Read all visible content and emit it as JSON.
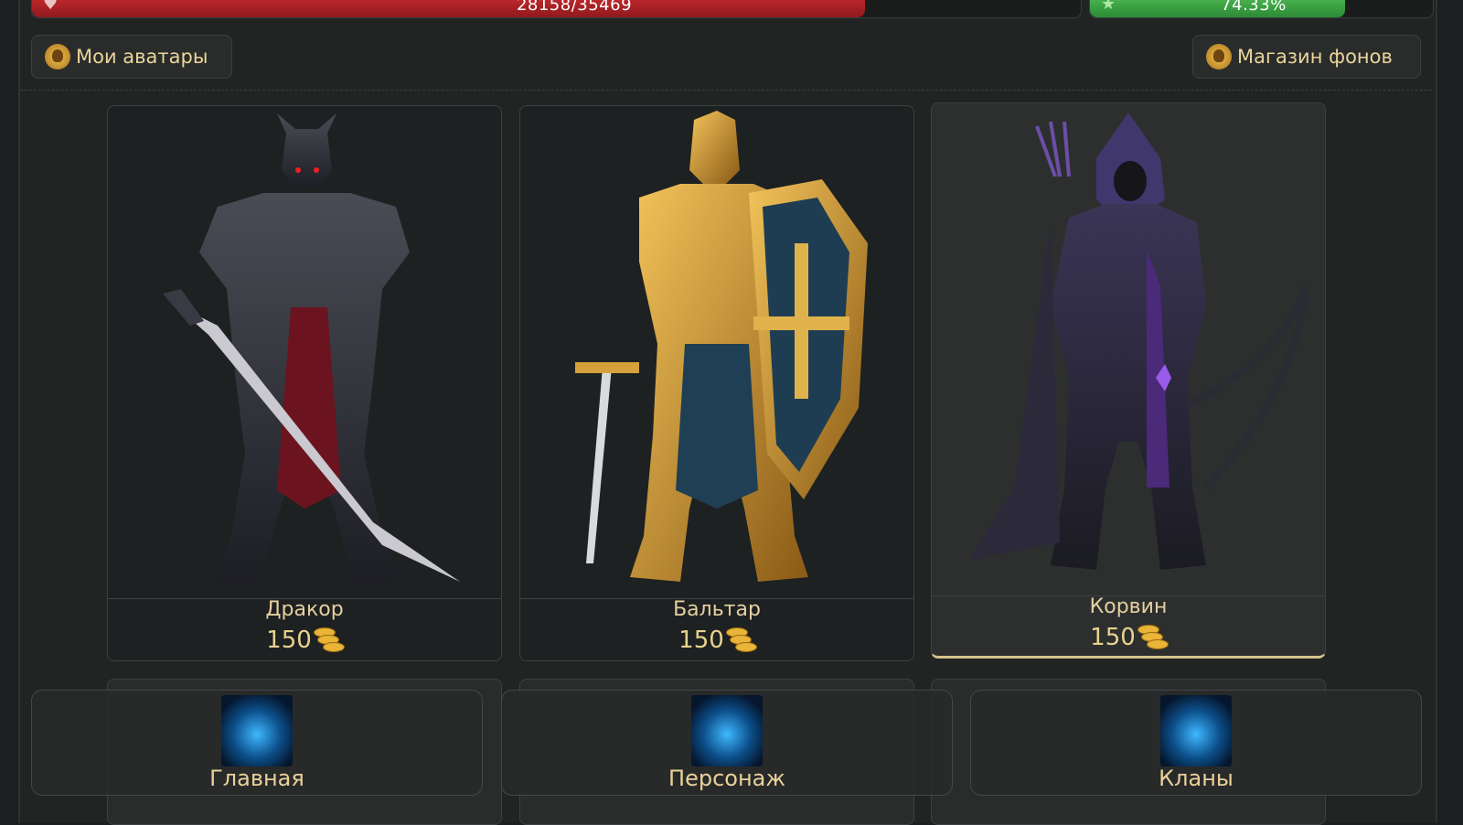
{
  "status": {
    "hp_text": "28158/35469",
    "hp_fraction": 0.7939,
    "xp_text": "74.33%",
    "xp_fraction": 0.7433
  },
  "header": {
    "my_avatars": "Мои аватары",
    "background_shop": "Магазин фонов"
  },
  "avatars": [
    {
      "name": "Дракор",
      "price": "150",
      "selected": false
    },
    {
      "name": "Бальтар",
      "price": "150",
      "selected": false
    },
    {
      "name": "Корвин",
      "price": "150",
      "selected": true
    }
  ],
  "nav": [
    {
      "label": "Главная",
      "icon": "castle-icon"
    },
    {
      "label": "Персонаж",
      "icon": "character-icon"
    },
    {
      "label": "Кланы",
      "icon": "clan-shield-icon"
    }
  ],
  "colors": {
    "hp_bar": "#c0282d",
    "xp_bar": "#4bb54f",
    "accent_text": "#e9d49a",
    "selected_border": "#d8c28c"
  }
}
